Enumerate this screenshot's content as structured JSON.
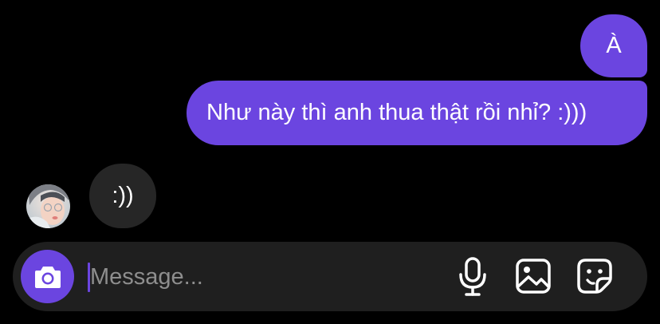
{
  "messages": [
    {
      "direction": "sent",
      "text": "À"
    },
    {
      "direction": "sent",
      "text": "Như này thì anh thua thật rồi nhỉ? :)))"
    },
    {
      "direction": "received",
      "text": ":))"
    }
  ],
  "composer": {
    "placeholder": "Message..."
  },
  "icons": {
    "camera": "camera-icon",
    "microphone": "microphone-icon",
    "gallery": "gallery-icon",
    "sticker": "sticker-icon"
  },
  "colors": {
    "background": "#000000",
    "sent_bubble": "#6b45e0",
    "received_bubble": "#262626",
    "composer": "#1f1f1f",
    "accent": "#6b45e0",
    "placeholder": "#8e8e8e"
  }
}
